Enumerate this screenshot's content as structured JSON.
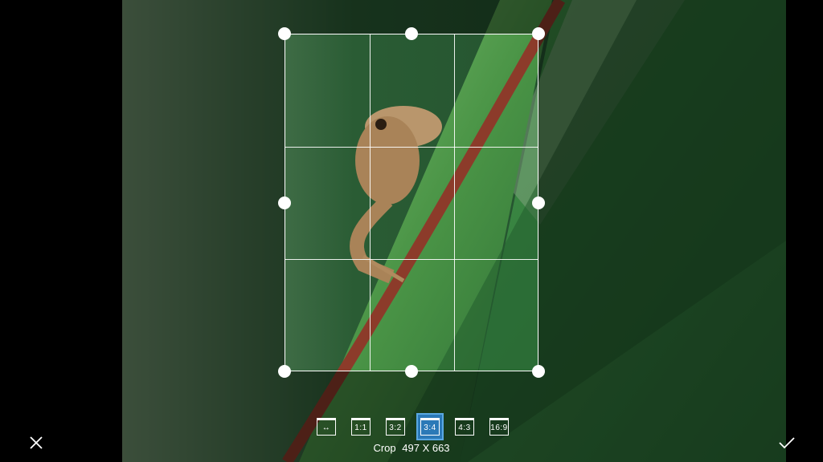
{
  "photo": {
    "subject": "lizard-on-leaf",
    "colors": {
      "bg_dark": "#1f4a28",
      "leaf": "#4f9a4b",
      "leaf_light": "#8bc97a",
      "stem": "#8c3b2a",
      "lizard": "#b9966c"
    }
  },
  "crop": {
    "label": "Crop",
    "dimensions": "497 X 663",
    "aspect_options": [
      {
        "label": "↔",
        "id": "free"
      },
      {
        "label": "1:1",
        "id": "1-1"
      },
      {
        "label": "3:2",
        "id": "3-2"
      },
      {
        "label": "3:4",
        "id": "3-4",
        "selected": true
      },
      {
        "label": "4:3",
        "id": "4-3"
      },
      {
        "label": "16:9",
        "id": "16-9"
      }
    ]
  },
  "accent_color": "#2b79b7",
  "icons": {
    "cancel": "close-icon",
    "confirm": "check-icon"
  }
}
